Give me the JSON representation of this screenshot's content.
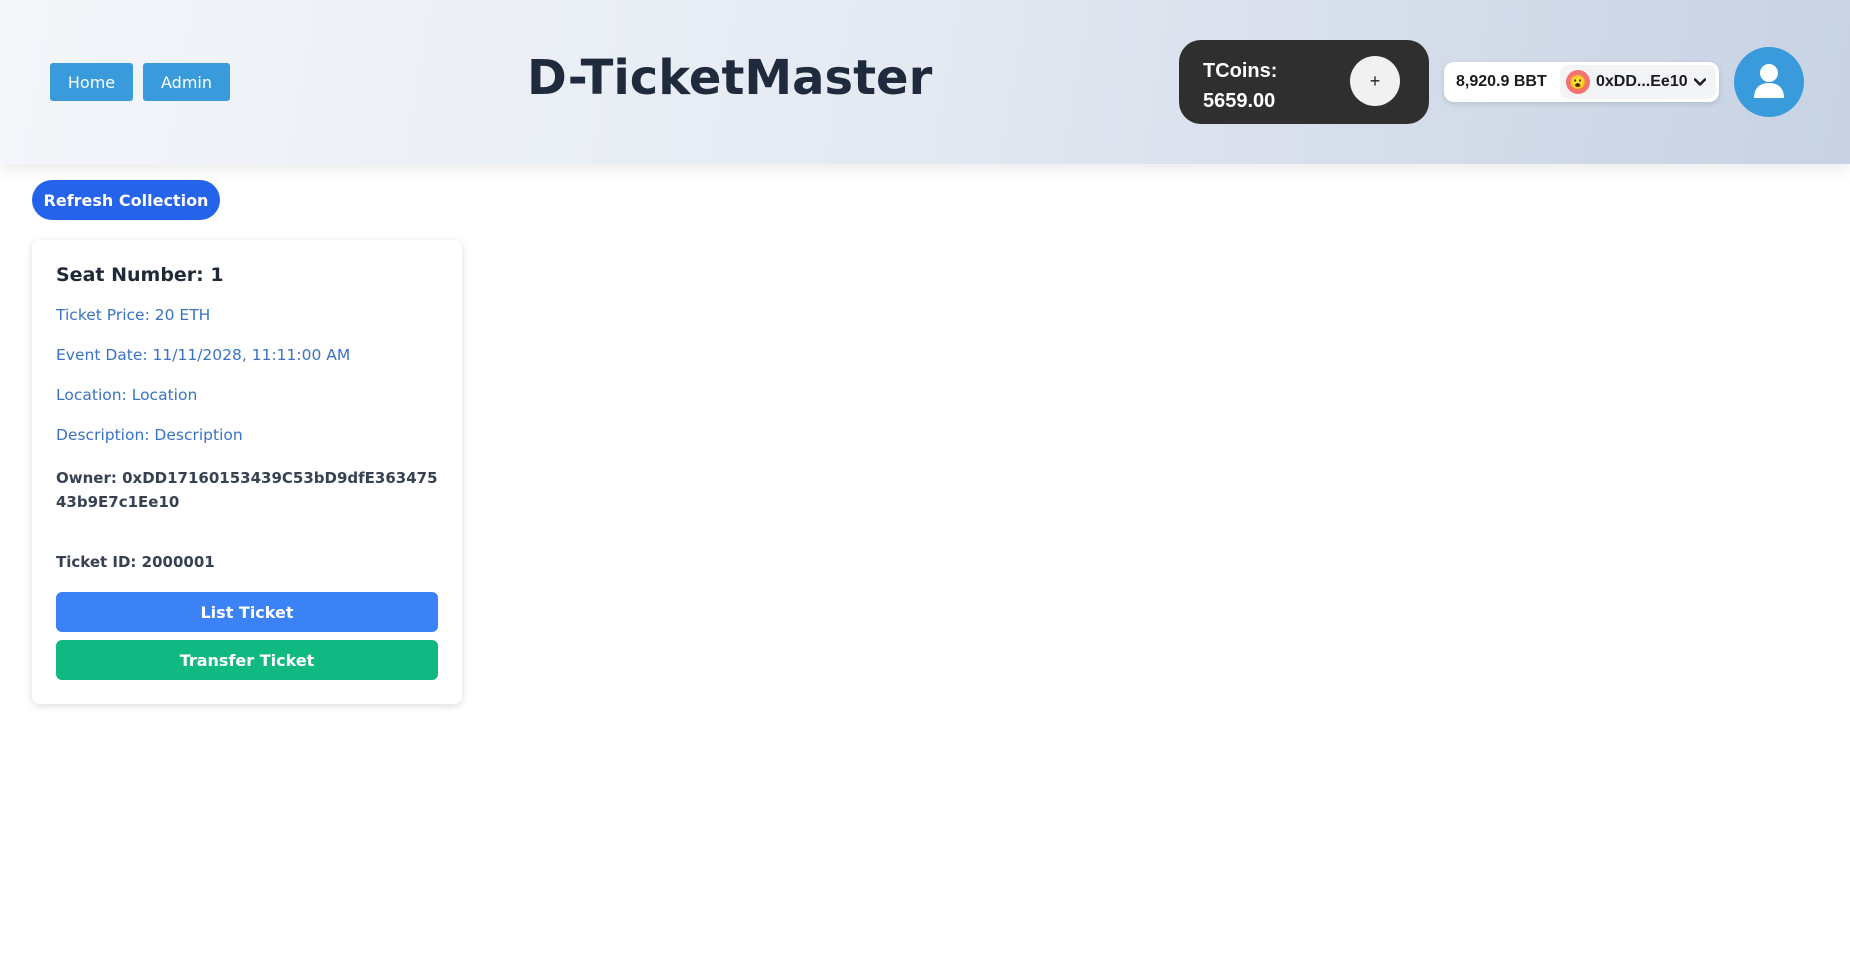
{
  "header": {
    "nav": {
      "home_label": "Home",
      "admin_label": "Admin"
    },
    "title": "D-TicketMaster",
    "tcoins": {
      "label": "TCoins:",
      "value": "5659.00",
      "add_label": "+"
    },
    "wallet": {
      "balance": "8,920.9 BBT",
      "account": "0xDD...Ee10",
      "avatar_emoji": "😮"
    },
    "profile_icon": "user-icon"
  },
  "main": {
    "refresh_label": "Refresh Collection",
    "tickets": [
      {
        "seat": "Seat Number: 1",
        "price": "Ticket Price: 20 ETH",
        "event_date": "Event Date: 11/11/2028, 11:11:00 AM",
        "location": "Location: Location",
        "description": "Description: Description",
        "owner": "Owner: 0xDD17160153439C53bD9dfE36347543b9E7c1Ee10",
        "ticket_id": "Ticket ID: 2000001",
        "list_label": "List Ticket",
        "transfer_label": "Transfer Ticket"
      }
    ]
  },
  "colors": {
    "nav_button": "#3a9bdc",
    "refresh_button": "#2563eb",
    "list_button": "#3b82f6",
    "transfer_button": "#10b981",
    "card_text": "#3a72c4",
    "tcoins_bg": "#2f2f2f"
  }
}
